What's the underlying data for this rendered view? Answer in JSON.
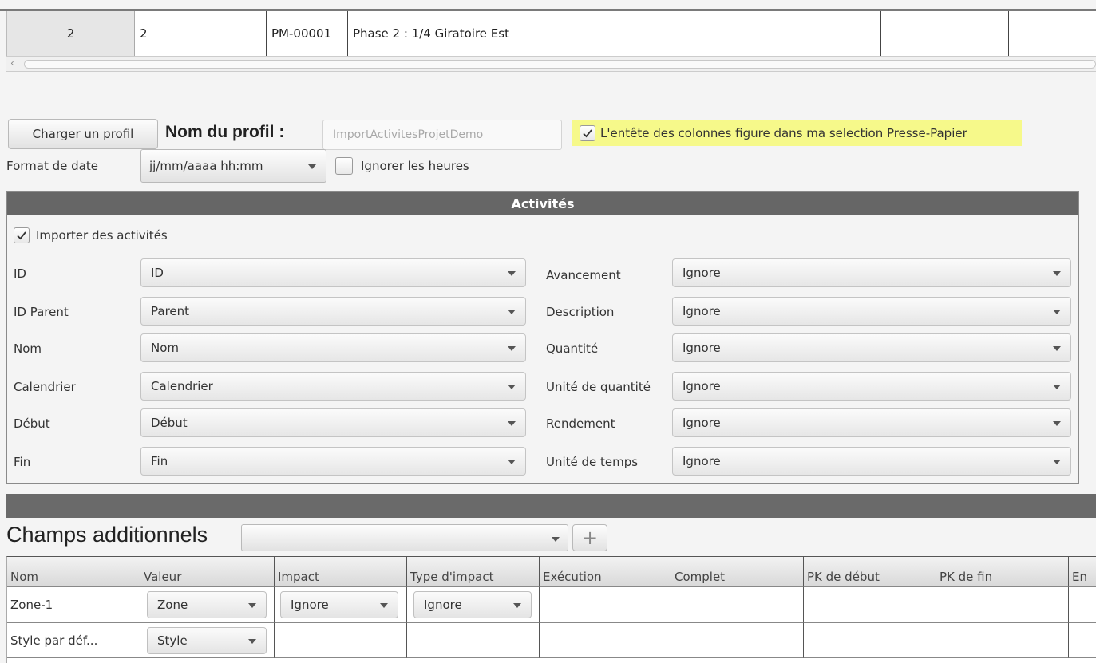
{
  "top_table": {
    "row": [
      "2",
      "2",
      "PM-00001",
      "Phase 2 : 1/4 Giratoire Est",
      "",
      "",
      ""
    ]
  },
  "profile": {
    "load_button": "Charger un profil",
    "name_label": "Nom du profil :",
    "name_placeholder": "ImportActivitesProjetDemo",
    "header_checkbox_label": "L'entête des colonnes figure dans ma selection Presse-Papier",
    "header_checkbox_checked": true,
    "date_format_label": "Format de date",
    "date_format_value": "jj/mm/aaaa hh:mm",
    "ignore_hours_label": "Ignorer les heures",
    "ignore_hours_checked": false
  },
  "activities": {
    "title": "Activités",
    "import_label": "Importer des activités",
    "import_checked": true,
    "left_fields": [
      {
        "label": "ID",
        "value": "ID"
      },
      {
        "label": "ID Parent",
        "value": "Parent"
      },
      {
        "label": "Nom",
        "value": "Nom"
      },
      {
        "label": "Calendrier",
        "value": "Calendrier"
      },
      {
        "label": "Début",
        "value": "Début"
      },
      {
        "label": "Fin",
        "value": "Fin"
      }
    ],
    "right_fields": [
      {
        "label": "Avancement",
        "value": "Ignore"
      },
      {
        "label": "Description",
        "value": "Ignore"
      },
      {
        "label": "Quantité",
        "value": "Ignore"
      },
      {
        "label": "Unité de quantité",
        "value": "Ignore"
      },
      {
        "label": "Rendement",
        "value": "Ignore"
      },
      {
        "label": "Unité de temps",
        "value": "Ignore"
      }
    ]
  },
  "additional": {
    "title": "Champs additionnels",
    "combo_value": "",
    "add_symbol": "+",
    "columns": [
      "Nom",
      "Valeur",
      "Impact",
      "Type d'impact",
      "Exécution",
      "Complet",
      "PK de début",
      "PK de fin",
      "En"
    ],
    "rows": [
      {
        "name": "Zone-1",
        "valeur": "Zone",
        "impact": "Ignore",
        "type": "Ignore"
      },
      {
        "name": "Style par déf...",
        "valeur": "Style",
        "impact": null,
        "type": null
      }
    ]
  },
  "icons": {
    "check": "checkmark-icon",
    "caret": "chevron-down-icon",
    "plus": "plus-icon",
    "scroll_left": "scroll-left-arrow-icon"
  },
  "colors": {
    "highlight": "#f6f98a",
    "panel_header": "#666666",
    "band": "#6a6a6a"
  }
}
